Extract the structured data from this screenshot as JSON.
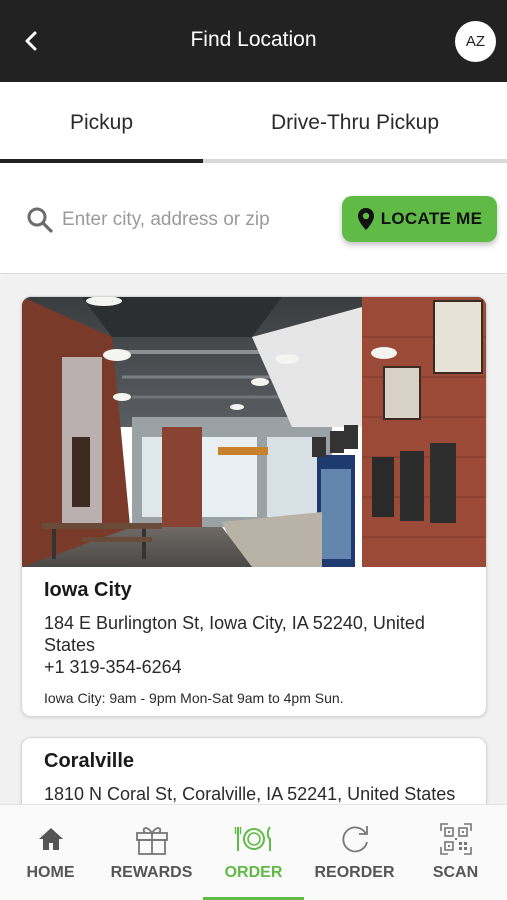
{
  "header": {
    "title": "Find Location",
    "avatar_initials": "AZ",
    "back_icon": "chevron-left-icon"
  },
  "tabs": [
    {
      "label": "Pickup",
      "active": true
    },
    {
      "label": "Drive-Thru Pickup",
      "active": false
    }
  ],
  "search": {
    "placeholder": "Enter city, address or zip",
    "value": "",
    "locate_label": "LOCATE ME",
    "locate_icon": "map-pin-icon"
  },
  "locations": [
    {
      "name": "Iowa City",
      "address": "184 E Burlington St, Iowa City, IA 52240, United States",
      "phone": "+1 319-354-6264",
      "hours": "Iowa City: 9am - 9pm Mon-Sat 9am to 4pm Sun."
    },
    {
      "name": "Coralville",
      "address": "1810 N Coral St, Coralville, IA 52241, United States"
    }
  ],
  "bottom_nav": [
    {
      "label": "HOME",
      "icon": "home-icon",
      "active": false
    },
    {
      "label": "REWARDS",
      "icon": "gift-icon",
      "active": false
    },
    {
      "label": "ORDER",
      "icon": "plate-cutlery-icon",
      "active": true
    },
    {
      "label": "REORDER",
      "icon": "refresh-icon",
      "active": false
    },
    {
      "label": "SCAN",
      "icon": "qr-code-icon",
      "active": false
    }
  ],
  "colors": {
    "header_bg": "#222222",
    "accent_green": "#5fba46",
    "list_bg": "#f1f1f1"
  }
}
